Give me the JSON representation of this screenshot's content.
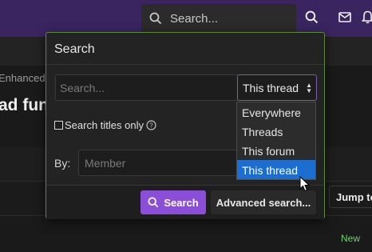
{
  "topbar": {
    "search_placeholder": "Search...",
    "icons": [
      "search-icon",
      "mail-icon",
      "bell-icon"
    ]
  },
  "page": {
    "breadcrumb": "Enhanced pr... functionality",
    "title": "ad functionality",
    "jump_label": "Jump to new",
    "new_badge": "New"
  },
  "popup": {
    "title": "Search",
    "search_placeholder": "Search...",
    "scope_value": "This thread",
    "titles_only_label": "Search titles only",
    "by_label": "By:",
    "member_placeholder": "Member",
    "search_button": "Search",
    "advanced_button": "Advanced search..."
  },
  "dropdown": {
    "options": [
      "Everywhere",
      "Threads",
      "This forum",
      "This thread"
    ],
    "selected": "This thread"
  },
  "colors": {
    "nav": "#3a2561",
    "accent": "#8a4fd6",
    "popup_border": "#5a8a3a",
    "selected_option": "#1c6dd0",
    "new_badge": "#6fd06f"
  }
}
